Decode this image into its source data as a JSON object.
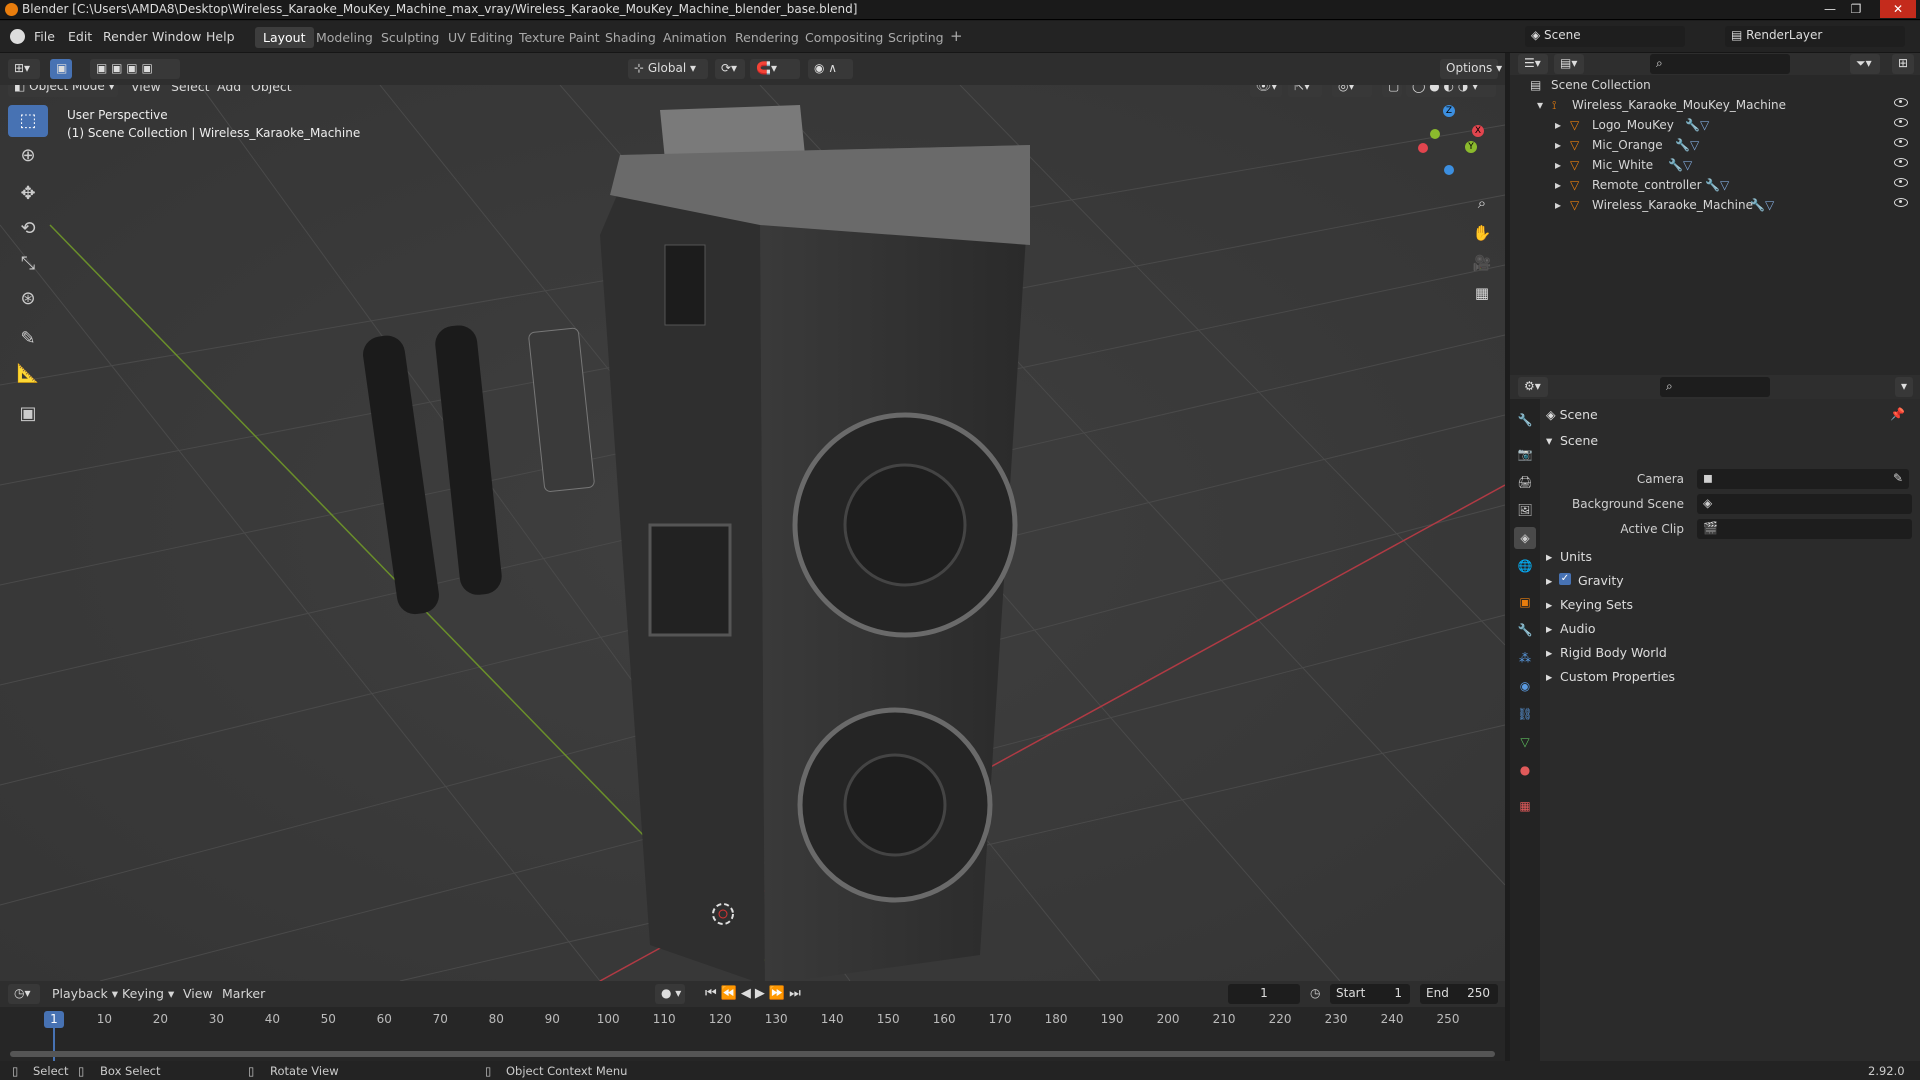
{
  "titlebar": {
    "title": "Blender [C:\\Users\\AMDA8\\Desktop\\Wireless_Karaoke_MouKey_Machine_max_vray/Wireless_Karaoke_MouKey_Machine_blender_base.blend]"
  },
  "menu": {
    "file": "File",
    "edit": "Edit",
    "render": "Render",
    "window": "Window",
    "help": "Help"
  },
  "workspaces": [
    "Layout",
    "Modeling",
    "Sculpting",
    "UV Editing",
    "Texture Paint",
    "Shading",
    "Animation",
    "Rendering",
    "Compositing",
    "Scripting"
  ],
  "top_right": {
    "scene": "Scene",
    "render_layer": "RenderLayer"
  },
  "header": {
    "orientation": "Global",
    "options": "Options"
  },
  "viewport_header": {
    "mode": "Object Mode",
    "view": "View",
    "select": "Select",
    "add": "Add",
    "object": "Object"
  },
  "viewport": {
    "perspective": "User Perspective",
    "collection_info": "(1) Scene Collection | Wireless_Karaoke_Machine"
  },
  "gizmo": {
    "x": "X",
    "y": "Y",
    "z": "Z"
  },
  "outliner": {
    "root": "Scene Collection",
    "collection": "Wireless_Karaoke_MouKey_Machine",
    "items": [
      "Logo_MouKey",
      "Mic_Orange",
      "Mic_White",
      "Remote_controller",
      "Wireless_Karaoke_Machine"
    ]
  },
  "properties": {
    "context": "Scene",
    "panel_title": "Scene",
    "camera_label": "Camera",
    "bg_scene_label": "Background Scene",
    "active_clip_label": "Active Clip",
    "panels": [
      "Units",
      "Gravity",
      "Keying Sets",
      "Audio",
      "Rigid Body World",
      "Custom Properties"
    ]
  },
  "timeline": {
    "playback": "Playback",
    "keying": "Keying",
    "view": "View",
    "marker": "Marker",
    "current_frame": "1",
    "start_label": "Start",
    "start": "1",
    "end_label": "End",
    "end": "250",
    "ticks": [
      "1",
      "10",
      "20",
      "30",
      "40",
      "50",
      "60",
      "70",
      "80",
      "90",
      "100",
      "110",
      "120",
      "130",
      "140",
      "150",
      "160",
      "170",
      "180",
      "190",
      "200",
      "210",
      "220",
      "230",
      "240",
      "250"
    ]
  },
  "status": {
    "select": "Select",
    "box_select": "Box Select",
    "rotate": "Rotate View",
    "context_menu": "Object Context Menu",
    "version": "2.92.0"
  },
  "colors": {
    "accent": "#4772b3",
    "orange": "#e87d0d",
    "x_axis": "#e2454e",
    "y_axis": "#8bba2d",
    "z_axis": "#3c8fe0"
  }
}
